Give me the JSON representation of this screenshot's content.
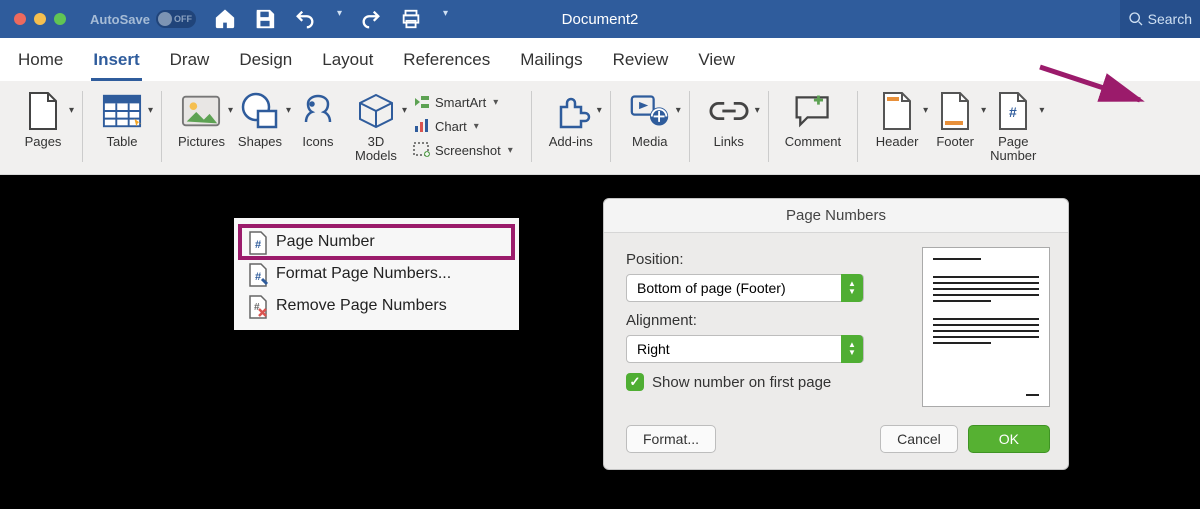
{
  "titlebar": {
    "autosave_label": "AutoSave",
    "autosave_state": "OFF",
    "doc_title": "Document2",
    "search_placeholder": "Search"
  },
  "tabs": [
    "Home",
    "Insert",
    "Draw",
    "Design",
    "Layout",
    "References",
    "Mailings",
    "Review",
    "View"
  ],
  "active_tab_index": 1,
  "ribbon": {
    "pages": "Pages",
    "table": "Table",
    "pictures": "Pictures",
    "shapes": "Shapes",
    "icons": "Icons",
    "models": "3D\nModels",
    "smartart": "SmartArt",
    "chart": "Chart",
    "screenshot": "Screenshot",
    "addins": "Add-ins",
    "media": "Media",
    "links": "Links",
    "comment": "Comment",
    "header": "Header",
    "footer": "Footer",
    "page_number": "Page\nNumber"
  },
  "dropdown": {
    "page_number": "Page Number",
    "format": "Format Page Numbers...",
    "remove": "Remove Page Numbers"
  },
  "dialog": {
    "title": "Page Numbers",
    "position_label": "Position:",
    "position_value": "Bottom of page (Footer)",
    "alignment_label": "Alignment:",
    "alignment_value": "Right",
    "show_first": "Show number on first page",
    "format_btn": "Format...",
    "cancel_btn": "Cancel",
    "ok_btn": "OK"
  }
}
